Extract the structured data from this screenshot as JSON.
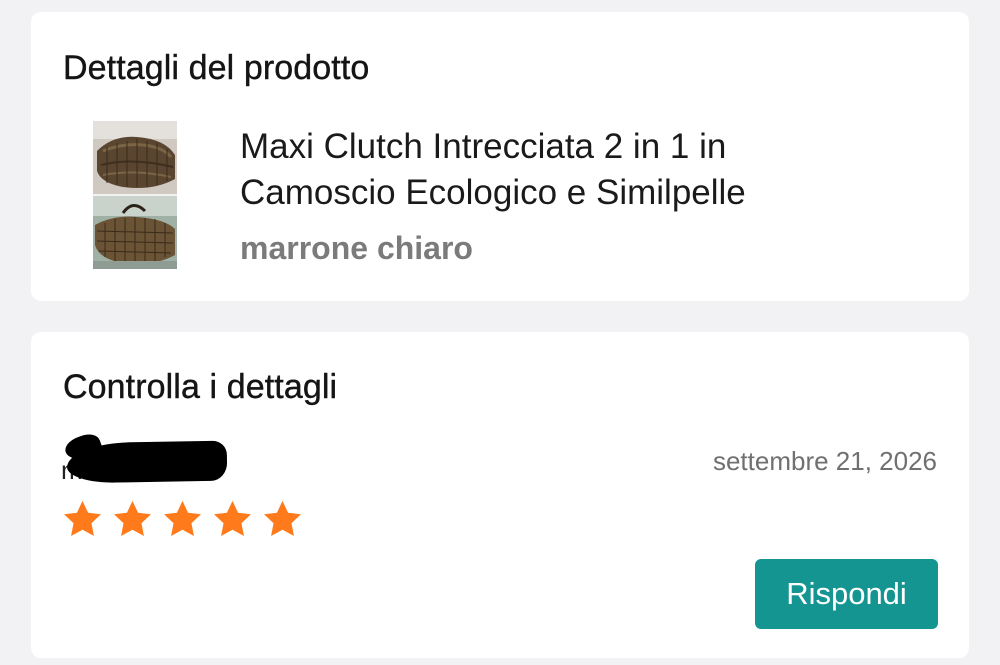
{
  "product_details": {
    "title": "Dettagli del prodotto",
    "product_name": "Maxi Clutch Intrecciata 2 in 1 in Camoscio Ecologico e Similpelle",
    "variant": "marrone chiaro"
  },
  "review": {
    "title": "Controlla i dettagli",
    "reviewer_name": "m       4",
    "date": "settembre 21, 2026",
    "rating": 5,
    "rating_max": 5,
    "star_color": "#ff7a1a",
    "reply_label": "Rispondi",
    "reply_color": "#149591"
  }
}
